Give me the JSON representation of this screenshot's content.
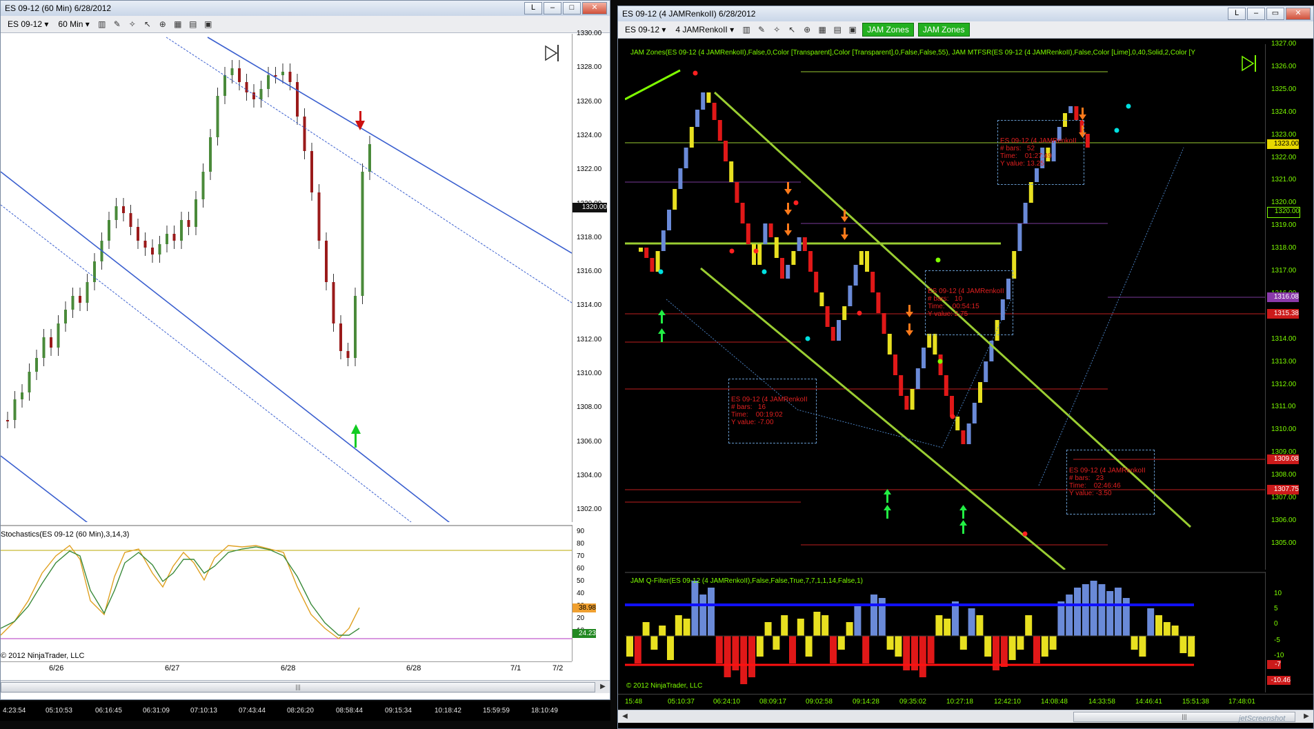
{
  "left_window": {
    "title": "ES 09-12 (60 Min)  6/28/2012",
    "instrument": "ES 09-12",
    "interval": "60 Min",
    "price_labels": [
      "1330.00",
      "1328.00",
      "1326.00",
      "1324.00",
      "1322.00",
      "1320.00",
      "1318.00",
      "1316.00",
      "1314.00",
      "1312.00",
      "1310.00",
      "1308.00",
      "1306.00",
      "1304.00",
      "1302.00"
    ],
    "current_price": "1320.00",
    "stoch_label": "Stochastics(ES 09-12 (60 Min),3,14,3)",
    "stoch_scale": [
      "90",
      "80",
      "70",
      "60",
      "50",
      "40",
      "30",
      "20",
      "10"
    ],
    "stoch_value_1": "38.98",
    "stoch_value_2": "24.23",
    "copyright": "© 2012 NinjaTrader, LLC",
    "date_labels": [
      "6/26",
      "6/27",
      "6/28",
      "6/28",
      "7/1",
      "7/2"
    ],
    "time_labels": [
      "4:23:54",
      "05:10:53",
      "06:16:45",
      "06:31:09",
      "07:10:13",
      "07:43:44",
      "08:26:20",
      "08:58:44",
      "09:15:34",
      "10:18:42",
      "15:59:59",
      "18:10:49"
    ]
  },
  "right_window": {
    "title": "ES 09-12 (4 JAMRenkoII)  6/28/2012",
    "instrument": "ES 09-12",
    "interval": "4 JAMRenkoII",
    "btn_zones_1": "JAM Zones",
    "btn_zones_2": "JAM Zones",
    "indicator_label": "JAM Zones(ES 09-12 (4 JAMRenkoII),False,0,Color [Transparent],Color [Transparent],0,False,False,55),  JAM MTFSR(ES 09-12 (4 JAMRenkoII),False,Color [Lime],0,40,Solid,2,Color [Y",
    "price_labels": [
      "1327.00",
      "1326.00",
      "1325.00",
      "1324.00",
      "1323.00",
      "1322.00",
      "1321.00",
      "1320.00",
      "1319.00",
      "1318.00",
      "1317.00",
      "1316.00",
      "1315.00",
      "1314.00",
      "1313.00",
      "1312.00",
      "1311.00",
      "1310.00",
      "1309.00",
      "1308.00",
      "1307.00",
      "1306.00",
      "1305.00"
    ],
    "flag_1323": "1323.00",
    "flag_1320": "1320.00",
    "flag_1316": "1316.08",
    "flag_1315": "1315.38",
    "flag_1309": "1309.08",
    "flag_1307": "1307.75",
    "qfilter_label": "JAM Q-Filter(ES 09-12 (4 JAMRenkoII),False,False,True,7,7,1,1,14,False,1)",
    "q_scale": [
      "10",
      "5",
      "0",
      "-5",
      "-10"
    ],
    "q_flag_1": "-7",
    "q_flag_2": "-10.46",
    "copyright": "© 2012 NinjaTrader, LLC",
    "time_labels": [
      "15:48",
      "05:10:37",
      "06:24:10",
      "08:09:17",
      "09:02:58",
      "09:14:28",
      "09:35:02",
      "10:27:18",
      "12:42:10",
      "14:08:48",
      "14:33:58",
      "14:46:41",
      "15:51:38",
      "17:48:01"
    ],
    "info_boxes": [
      {
        "title": "ES 09-12 (4 JAMRenkoII",
        "bars": "# bars:   52",
        "time": "Time:    01:27:49",
        "yval": "Y value: 13.25"
      },
      {
        "title": "ES 09-12 (4 JAMRenkoII",
        "bars": "# bars:   10",
        "time": "Time:    00:54:15",
        "yval": "Y value: 2.75"
      },
      {
        "title": "ES 09-12 (4 JAMRenkoII",
        "bars": "# bars:   16",
        "time": "Time:    00:19:02",
        "yval": "Y value: -7.00"
      },
      {
        "title": "ES 09-12 (4 JAMRenkoII",
        "bars": "# bars:   23",
        "time": "Time:    02:46:46",
        "yval": "Y value: -3.50"
      }
    ]
  },
  "watermark": "jetScreenshot"
}
